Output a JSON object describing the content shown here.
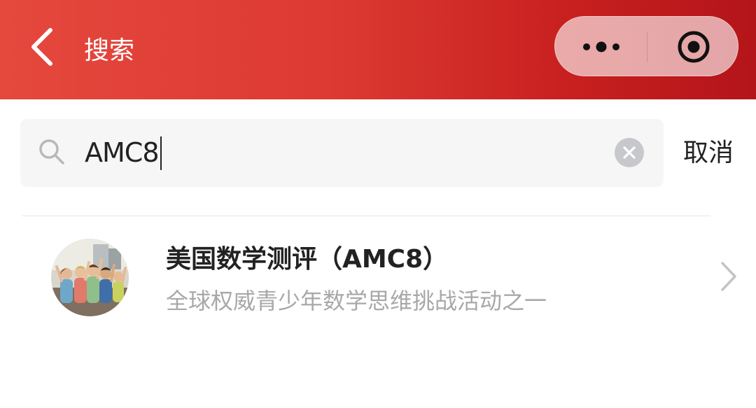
{
  "header": {
    "title": "搜索",
    "back_icon": "chevron-left-icon",
    "more_icon": "more-dots-icon",
    "close_icon": "target-close-icon",
    "gradient_colors": [
      "#e5483d",
      "#b3151a"
    ]
  },
  "search": {
    "value": "AMC8",
    "icon": "search-icon",
    "clear_icon": "clear-circle-icon",
    "cancel_label": "取消"
  },
  "results": [
    {
      "title": "美国数学测评（AMC8）",
      "description": "全球权威青少年数学思维挑战活动之一",
      "avatar": "group-photo-avatar",
      "arrow_icon": "chevron-right-icon"
    }
  ]
}
